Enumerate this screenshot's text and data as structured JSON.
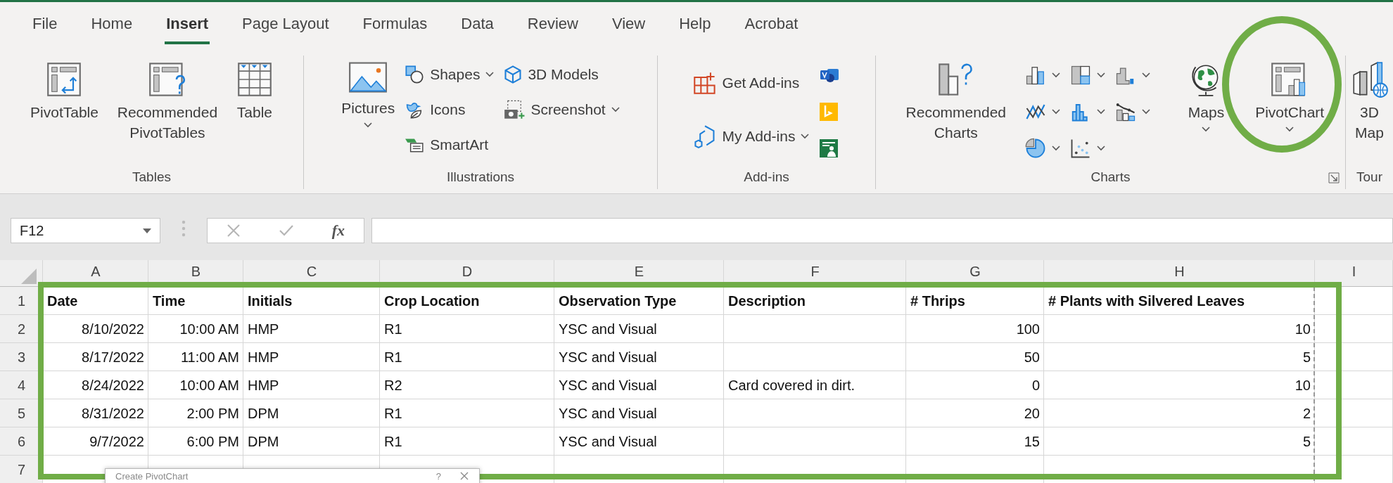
{
  "tabs": [
    {
      "label": "File",
      "selected": false
    },
    {
      "label": "Home",
      "selected": false
    },
    {
      "label": "Insert",
      "selected": true
    },
    {
      "label": "Page Layout",
      "selected": false
    },
    {
      "label": "Formulas",
      "selected": false
    },
    {
      "label": "Data",
      "selected": false
    },
    {
      "label": "Review",
      "selected": false
    },
    {
      "label": "View",
      "selected": false
    },
    {
      "label": "Help",
      "selected": false
    },
    {
      "label": "Acrobat",
      "selected": false
    }
  ],
  "ribbon_groups": [
    {
      "label": "Tables",
      "launcher": false,
      "columns": [
        [
          {
            "kind": "large",
            "label": "PivotTable",
            "dropdown": false
          }
        ],
        [
          {
            "kind": "large",
            "label": "Recommended PivotTables",
            "dropdown": false
          }
        ],
        [
          {
            "kind": "large",
            "label": "Table",
            "dropdown": false
          }
        ]
      ]
    },
    {
      "label": "Illustrations",
      "launcher": false,
      "columns": [
        [
          {
            "kind": "large",
            "label": "Pictures",
            "dropdown": true
          }
        ],
        [
          {
            "kind": "small",
            "label": "Shapes",
            "dropdown": true
          },
          {
            "kind": "small",
            "label": "Icons",
            "dropdown": false
          },
          {
            "kind": "small",
            "label": "SmartArt",
            "dropdown": false
          }
        ],
        [
          {
            "kind": "small",
            "label": "3D Models",
            "dropdown": false
          },
          {
            "kind": "small",
            "label": "Screenshot",
            "dropdown": true
          }
        ]
      ]
    },
    {
      "label": "Add-ins",
      "launcher": false,
      "columns": [
        [
          {
            "kind": "small",
            "label": "Get Add-ins",
            "dropdown": false
          },
          {
            "kind": "small",
            "label": "My Add-ins",
            "dropdown": true
          }
        ],
        [
          {
            "kind": "icon",
            "dropdown": false
          },
          {
            "kind": "icon",
            "dropdown": false
          },
          {
            "kind": "icon",
            "dropdown": false
          }
        ]
      ]
    },
    {
      "label": "Charts",
      "launcher": true,
      "columns": [
        [
          {
            "kind": "large",
            "label": "Recommended Charts",
            "dropdown": false
          }
        ],
        [
          {
            "kind": "icon",
            "dropdown": true
          },
          {
            "kind": "icon",
            "dropdown": true
          },
          {
            "kind": "icon",
            "dropdown": true
          }
        ],
        [
          {
            "kind": "icon",
            "dropdown": true
          },
          {
            "kind": "icon",
            "dropdown": true
          },
          {
            "kind": "icon",
            "dropdown": true
          }
        ],
        [
          {
            "kind": "icon",
            "dropdown": true
          },
          {
            "kind": "icon",
            "dropdown": true
          }
        ],
        [
          {
            "kind": "large",
            "label": "Maps",
            "dropdown": true
          }
        ],
        [
          {
            "kind": "large",
            "label": "PivotChart",
            "dropdown": true
          }
        ]
      ]
    },
    {
      "label": "Tour",
      "launcher": false,
      "columns": [
        [
          {
            "kind": "large",
            "label": "3D Map",
            "dropdown": false
          }
        ]
      ]
    }
  ],
  "formula_bar": {
    "name_box": "F12",
    "function_label": "fx"
  },
  "sheet": {
    "columns": [
      "A",
      "B",
      "C",
      "D",
      "E",
      "F",
      "G",
      "H",
      "I"
    ],
    "header_row": {
      "number": "1",
      "cells": [
        "Date",
        "Time",
        "Initials",
        "Crop Location",
        "Observation Type",
        "Description",
        "# Thrips",
        "# Plants with Silvered Leaves"
      ]
    },
    "rows": [
      {
        "number": "2",
        "cells": [
          "8/10/2022",
          "10:00 AM",
          "HMP",
          "R1",
          "YSC and Visual",
          null,
          "100",
          "10"
        ]
      },
      {
        "number": "3",
        "cells": [
          "8/17/2022",
          "11:00 AM",
          "HMP",
          "R1",
          "YSC and Visual",
          null,
          "50",
          "5"
        ]
      },
      {
        "number": "4",
        "cells": [
          "8/24/2022",
          "10:00 AM",
          "HMP",
          "R2",
          "YSC and Visual",
          "Card covered in dirt.",
          "0",
          "10"
        ]
      },
      {
        "number": "5",
        "cells": [
          "8/31/2022",
          "2:00 PM",
          "DPM",
          "R1",
          "YSC and Visual",
          null,
          "20",
          "2"
        ]
      },
      {
        "number": "6",
        "cells": [
          "9/7/2022",
          "6:00 PM",
          "DPM",
          "R1",
          "YSC and Visual",
          null,
          "15",
          "5"
        ]
      },
      {
        "number": "7",
        "cells": []
      }
    ]
  },
  "dialog": {
    "title": "Create PivotChart",
    "help": "?"
  }
}
